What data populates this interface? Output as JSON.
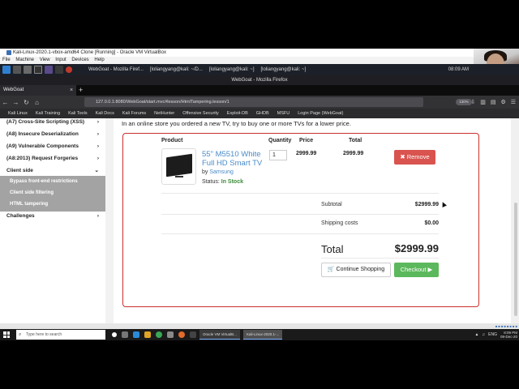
{
  "vbox": {
    "title": "Kali-Linux-2020.1-vbox-amd64 Clone [Running] - Oracle VM VirtualBox",
    "menu": [
      "File",
      "Machine",
      "View",
      "Input",
      "Devices",
      "Help"
    ]
  },
  "kali_taskbar": {
    "tasks": [
      "WebGoat - Mozilla Firef...",
      "[loliangyang@kali: ~/D...",
      "[loliangyang@kali: ~]",
      "[loliangyang@kali: ~]"
    ],
    "clock": "08:09 AM"
  },
  "firefox": {
    "window_title": "WebGoat - Mozilla Firefox",
    "tab_title": "WebGoat",
    "tab_close": "×",
    "newtab": "+",
    "url": "127.0.0.1:8080/WebGoat/start.mvc#lesson/HtmlTampering.lesson/1",
    "zoom": "130%",
    "bookmarks": [
      "Kali Linux",
      "Kali Training",
      "Kali Tools",
      "Kali Docs",
      "Kali Forums",
      "NetHunter",
      "Offensive Security",
      "Exploit-DB",
      "GHDB",
      "MSFU",
      "Login Page (WebGoat)"
    ]
  },
  "sidebar": {
    "items": [
      {
        "label": "(A7) Cross-Site Scripting (XSS)",
        "chev": "›"
      },
      {
        "label": "(A8) Insecure Deserialization",
        "chev": "›"
      },
      {
        "label": "(A9) Vulnerable Components",
        "chev": "›"
      },
      {
        "label": "(A8:2013) Request Forgeries",
        "chev": "›"
      },
      {
        "label": "Client side",
        "chev": "⌄"
      }
    ],
    "sub": [
      "Bypass front-end restrictions",
      "Client side filtering",
      "HTML tampering"
    ],
    "challenges": {
      "label": "Challenges",
      "chev": "›"
    }
  },
  "lesson": {
    "intro": "In an online store you ordered a new TV, try to buy one or more TVs for a lower price."
  },
  "cart": {
    "headers": {
      "product": "Product",
      "quantity": "Quantity",
      "price": "Price",
      "total": "Total"
    },
    "item": {
      "name": "55\" M5510 White Full HD Smart TV",
      "by_prefix": "by",
      "brand": "Samsung",
      "status_prefix": "Status:",
      "status": "In Stock",
      "quantity": "1",
      "price": "2999.99",
      "total": "2999.99"
    },
    "remove_label": "✖ Remove",
    "subtotal_label": "Subtotal",
    "subtotal": "$2999.99",
    "shipping_label": "Shipping costs",
    "shipping": "$0.00",
    "total_label": "Total",
    "total": "$2999.99",
    "continue_label": "🛒 Continue Shopping",
    "checkout_label": "Checkout ▶",
    "colors": {
      "border": "#c9302c",
      "remove": "#d9534f",
      "checkout": "#5cb85c",
      "link": "#4a8bc9"
    }
  },
  "windows": {
    "search_placeholder": "Type here to search",
    "apps": [
      "Oracle VM VirtualB...",
      "Kali-Linux-2020.1-..."
    ],
    "time": "8:09 PM",
    "date": "09-Dec-20",
    "lang": "ENG"
  }
}
